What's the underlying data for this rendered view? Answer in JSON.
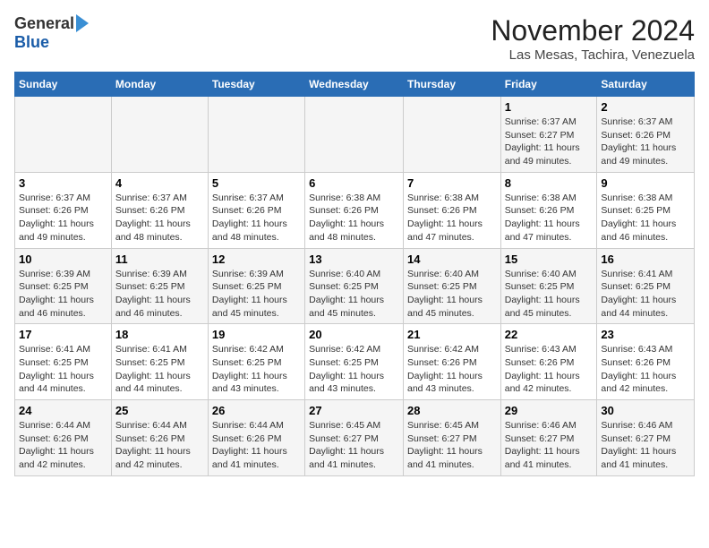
{
  "logo": {
    "general": "General",
    "blue": "Blue"
  },
  "header": {
    "month": "November 2024",
    "location": "Las Mesas, Tachira, Venezuela"
  },
  "weekdays": [
    "Sunday",
    "Monday",
    "Tuesday",
    "Wednesday",
    "Thursday",
    "Friday",
    "Saturday"
  ],
  "weeks": [
    [
      {
        "day": "",
        "info": ""
      },
      {
        "day": "",
        "info": ""
      },
      {
        "day": "",
        "info": ""
      },
      {
        "day": "",
        "info": ""
      },
      {
        "day": "",
        "info": ""
      },
      {
        "day": "1",
        "info": "Sunrise: 6:37 AM\nSunset: 6:27 PM\nDaylight: 11 hours and 49 minutes."
      },
      {
        "day": "2",
        "info": "Sunrise: 6:37 AM\nSunset: 6:26 PM\nDaylight: 11 hours and 49 minutes."
      }
    ],
    [
      {
        "day": "3",
        "info": "Sunrise: 6:37 AM\nSunset: 6:26 PM\nDaylight: 11 hours and 49 minutes."
      },
      {
        "day": "4",
        "info": "Sunrise: 6:37 AM\nSunset: 6:26 PM\nDaylight: 11 hours and 48 minutes."
      },
      {
        "day": "5",
        "info": "Sunrise: 6:37 AM\nSunset: 6:26 PM\nDaylight: 11 hours and 48 minutes."
      },
      {
        "day": "6",
        "info": "Sunrise: 6:38 AM\nSunset: 6:26 PM\nDaylight: 11 hours and 48 minutes."
      },
      {
        "day": "7",
        "info": "Sunrise: 6:38 AM\nSunset: 6:26 PM\nDaylight: 11 hours and 47 minutes."
      },
      {
        "day": "8",
        "info": "Sunrise: 6:38 AM\nSunset: 6:26 PM\nDaylight: 11 hours and 47 minutes."
      },
      {
        "day": "9",
        "info": "Sunrise: 6:38 AM\nSunset: 6:25 PM\nDaylight: 11 hours and 46 minutes."
      }
    ],
    [
      {
        "day": "10",
        "info": "Sunrise: 6:39 AM\nSunset: 6:25 PM\nDaylight: 11 hours and 46 minutes."
      },
      {
        "day": "11",
        "info": "Sunrise: 6:39 AM\nSunset: 6:25 PM\nDaylight: 11 hours and 46 minutes."
      },
      {
        "day": "12",
        "info": "Sunrise: 6:39 AM\nSunset: 6:25 PM\nDaylight: 11 hours and 45 minutes."
      },
      {
        "day": "13",
        "info": "Sunrise: 6:40 AM\nSunset: 6:25 PM\nDaylight: 11 hours and 45 minutes."
      },
      {
        "day": "14",
        "info": "Sunrise: 6:40 AM\nSunset: 6:25 PM\nDaylight: 11 hours and 45 minutes."
      },
      {
        "day": "15",
        "info": "Sunrise: 6:40 AM\nSunset: 6:25 PM\nDaylight: 11 hours and 45 minutes."
      },
      {
        "day": "16",
        "info": "Sunrise: 6:41 AM\nSunset: 6:25 PM\nDaylight: 11 hours and 44 minutes."
      }
    ],
    [
      {
        "day": "17",
        "info": "Sunrise: 6:41 AM\nSunset: 6:25 PM\nDaylight: 11 hours and 44 minutes."
      },
      {
        "day": "18",
        "info": "Sunrise: 6:41 AM\nSunset: 6:25 PM\nDaylight: 11 hours and 44 minutes."
      },
      {
        "day": "19",
        "info": "Sunrise: 6:42 AM\nSunset: 6:25 PM\nDaylight: 11 hours and 43 minutes."
      },
      {
        "day": "20",
        "info": "Sunrise: 6:42 AM\nSunset: 6:25 PM\nDaylight: 11 hours and 43 minutes."
      },
      {
        "day": "21",
        "info": "Sunrise: 6:42 AM\nSunset: 6:26 PM\nDaylight: 11 hours and 43 minutes."
      },
      {
        "day": "22",
        "info": "Sunrise: 6:43 AM\nSunset: 6:26 PM\nDaylight: 11 hours and 42 minutes."
      },
      {
        "day": "23",
        "info": "Sunrise: 6:43 AM\nSunset: 6:26 PM\nDaylight: 11 hours and 42 minutes."
      }
    ],
    [
      {
        "day": "24",
        "info": "Sunrise: 6:44 AM\nSunset: 6:26 PM\nDaylight: 11 hours and 42 minutes."
      },
      {
        "day": "25",
        "info": "Sunrise: 6:44 AM\nSunset: 6:26 PM\nDaylight: 11 hours and 42 minutes."
      },
      {
        "day": "26",
        "info": "Sunrise: 6:44 AM\nSunset: 6:26 PM\nDaylight: 11 hours and 41 minutes."
      },
      {
        "day": "27",
        "info": "Sunrise: 6:45 AM\nSunset: 6:27 PM\nDaylight: 11 hours and 41 minutes."
      },
      {
        "day": "28",
        "info": "Sunrise: 6:45 AM\nSunset: 6:27 PM\nDaylight: 11 hours and 41 minutes."
      },
      {
        "day": "29",
        "info": "Sunrise: 6:46 AM\nSunset: 6:27 PM\nDaylight: 11 hours and 41 minutes."
      },
      {
        "day": "30",
        "info": "Sunrise: 6:46 AM\nSunset: 6:27 PM\nDaylight: 11 hours and 41 minutes."
      }
    ]
  ]
}
